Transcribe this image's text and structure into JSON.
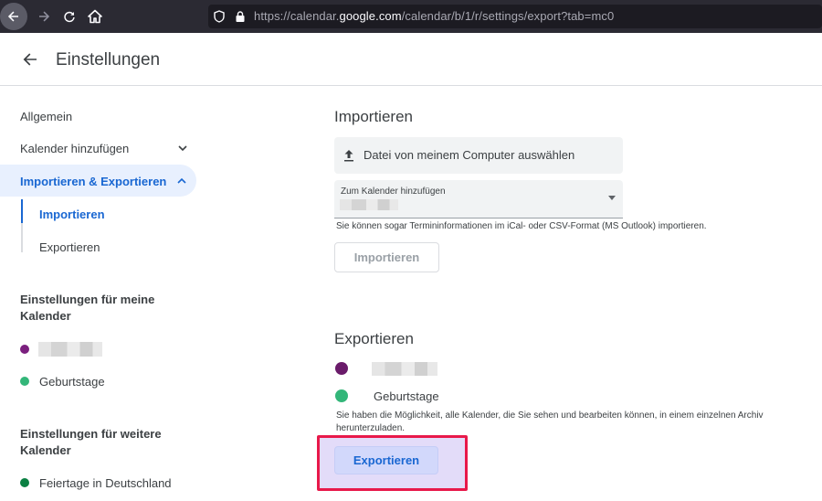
{
  "browser": {
    "url_prefix": "https://calendar.",
    "url_domain": "google.com",
    "url_suffix": "/calendar/b/1/r/settings/export?tab=mc0"
  },
  "header": {
    "title": "Einstellungen"
  },
  "sidebar": {
    "items": [
      {
        "label": "Allgemein"
      },
      {
        "label": "Kalender hinzufügen"
      },
      {
        "label": "Importieren & Exportieren"
      },
      {
        "label": "Importieren"
      },
      {
        "label": "Exportieren"
      }
    ],
    "my_calendars_title": "Einstellungen für meine Kalender",
    "my_calendars": [
      {
        "label": "",
        "color": "#7b1f7e"
      },
      {
        "label": "Geburtstage",
        "color": "#33b679"
      }
    ],
    "other_calendars_title": "Einstellungen für weitere Kalender",
    "other_calendars": [
      {
        "label": "Feiertage in Deutschland",
        "color": "#0b8043"
      }
    ]
  },
  "import": {
    "heading": "Importieren",
    "file_button": "Datei von meinem Computer auswählen",
    "select_label": "Zum Kalender hinzufügen",
    "hint": "Sie können sogar Termininformationen im iCal- oder CSV-Format (MS Outlook) importieren.",
    "button": "Importieren"
  },
  "export": {
    "heading": "Exportieren",
    "calendars": [
      {
        "label": "",
        "color": "#6a1b6a"
      },
      {
        "label": "Geburtstage",
        "color": "#33b679"
      }
    ],
    "hint": "Sie haben die Möglichkeit, alle Kalender, die Sie sehen und bearbeiten können, in einem einzelnen Archiv herunterzuladen.",
    "button": "Exportieren"
  },
  "colors": {
    "accent": "#1967d2",
    "highlight": "#e8194a"
  }
}
